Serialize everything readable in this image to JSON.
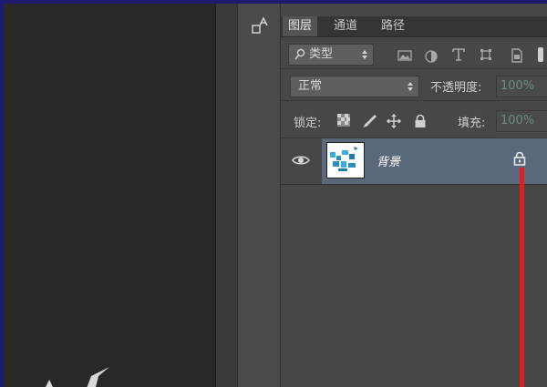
{
  "panel": {
    "tabs": [
      {
        "label": "图层",
        "active": true
      },
      {
        "label": "通道",
        "active": false
      },
      {
        "label": "路径",
        "active": false
      }
    ],
    "filter": {
      "label": "类型"
    },
    "blend": {
      "value": "正常"
    },
    "opacity": {
      "label": "不透明度:",
      "value": "100%"
    },
    "lock": {
      "label": "锁定:"
    },
    "fill": {
      "label": "填充:",
      "value": "100%"
    },
    "layers": [
      {
        "name": "背景",
        "locked": true,
        "visible": true
      }
    ]
  },
  "colors": {
    "accent_selected": "#59687a",
    "annotation_red": "#e11d1d",
    "window_border": "#1e1a6e"
  }
}
